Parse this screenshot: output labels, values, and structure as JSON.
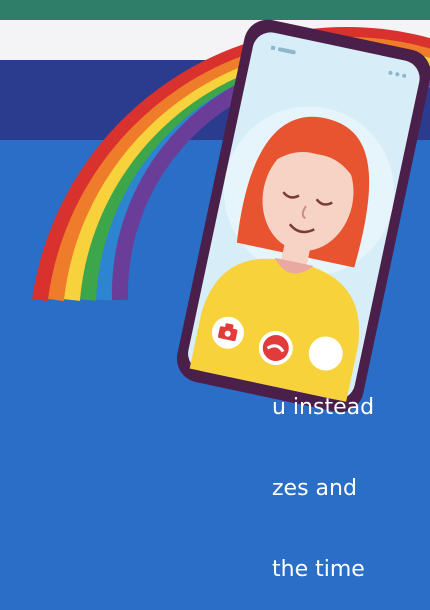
{
  "caption": {
    "line1": "u instead",
    "line2": "zes and",
    "line3": "the time"
  },
  "colors": {
    "background_blue": "#2a6ec8",
    "top_green_bar": "#2f7e6a",
    "white_band": "#f4f4f6",
    "navy_band": "#2b3c8e",
    "rainbow": [
      "#d8312e",
      "#ef7c2a",
      "#f8d23c",
      "#3ea64a",
      "#2d84d0",
      "#6a3e98"
    ],
    "phone_frame": "#4a1f4a",
    "phone_screen": "#d7eef8",
    "hair": "#e8542f",
    "skin": "#f6d3c4",
    "shirt": "#f7d23b",
    "call_button_red": "#e23b3b"
  },
  "icons": [
    "camera-icon",
    "end-call-icon",
    "status-signal-icon",
    "status-dots-icon"
  ]
}
